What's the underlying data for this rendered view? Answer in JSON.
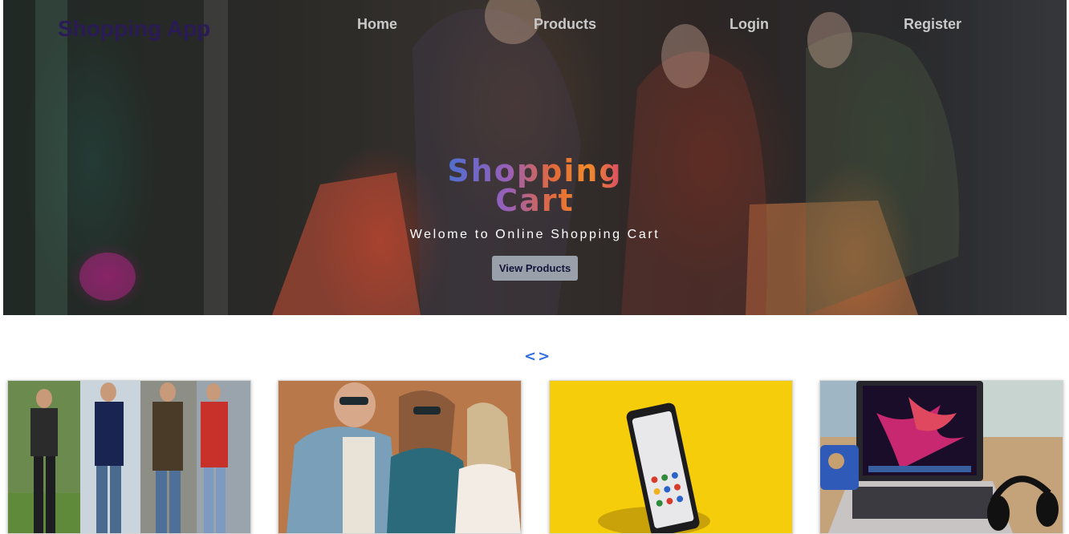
{
  "nav": {
    "brand": "Shopping App",
    "links": [
      "Home",
      "Products",
      "Login",
      "Register"
    ]
  },
  "hero": {
    "title": "Shopping Cart",
    "subtitle": "Welome to Online Shopping Cart",
    "button": "View Products"
  },
  "carousel": {
    "prev": "<",
    "next": ">"
  },
  "colors": {
    "brand": "#2a1a55",
    "accent": "#2f6de0",
    "button_bg": "#9aa0aa"
  },
  "products": [
    {
      "image": "men-fashion-photo"
    },
    {
      "image": "women-sunglasses-photo"
    },
    {
      "image": "smartphone-yellow-photo"
    },
    {
      "image": "laptop-headphones-photo"
    }
  ]
}
